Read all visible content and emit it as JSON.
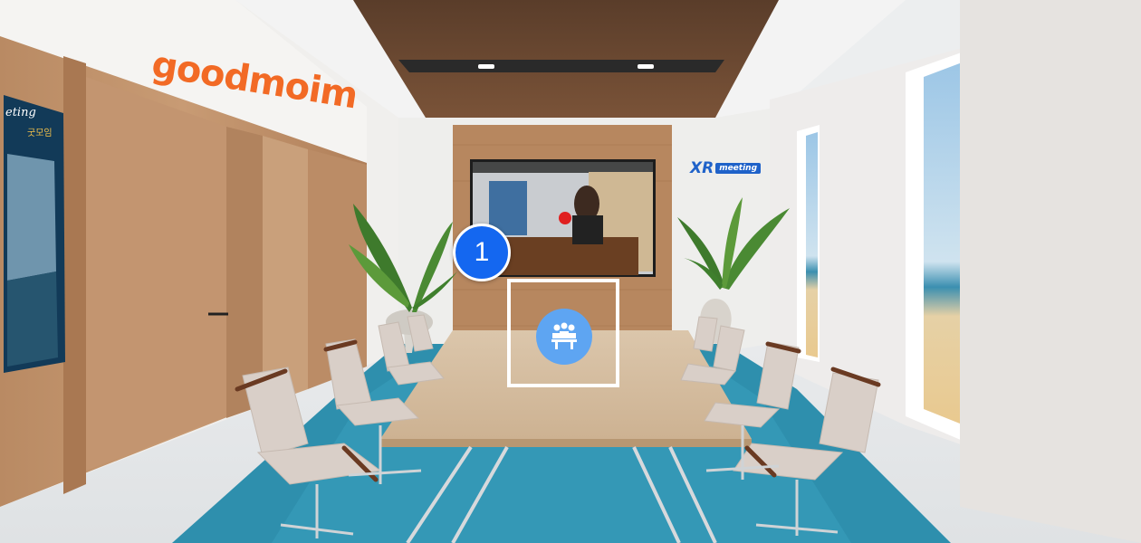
{
  "scene": {
    "wall_brand": "goodmoim",
    "wall_sign": {
      "line1": "eting",
      "line2": "굿모임"
    },
    "xr_logo": {
      "xr": "XR",
      "meeting": "meeting"
    },
    "tutorial_step": "1",
    "hotspot": {
      "icon": "meeting-people-icon"
    }
  },
  "colors": {
    "brand_orange": "#f26a25",
    "step_badge_blue": "#1467f0",
    "hotspot_blue": "#5ea5f2",
    "carpet_teal": "#2e8fad"
  }
}
